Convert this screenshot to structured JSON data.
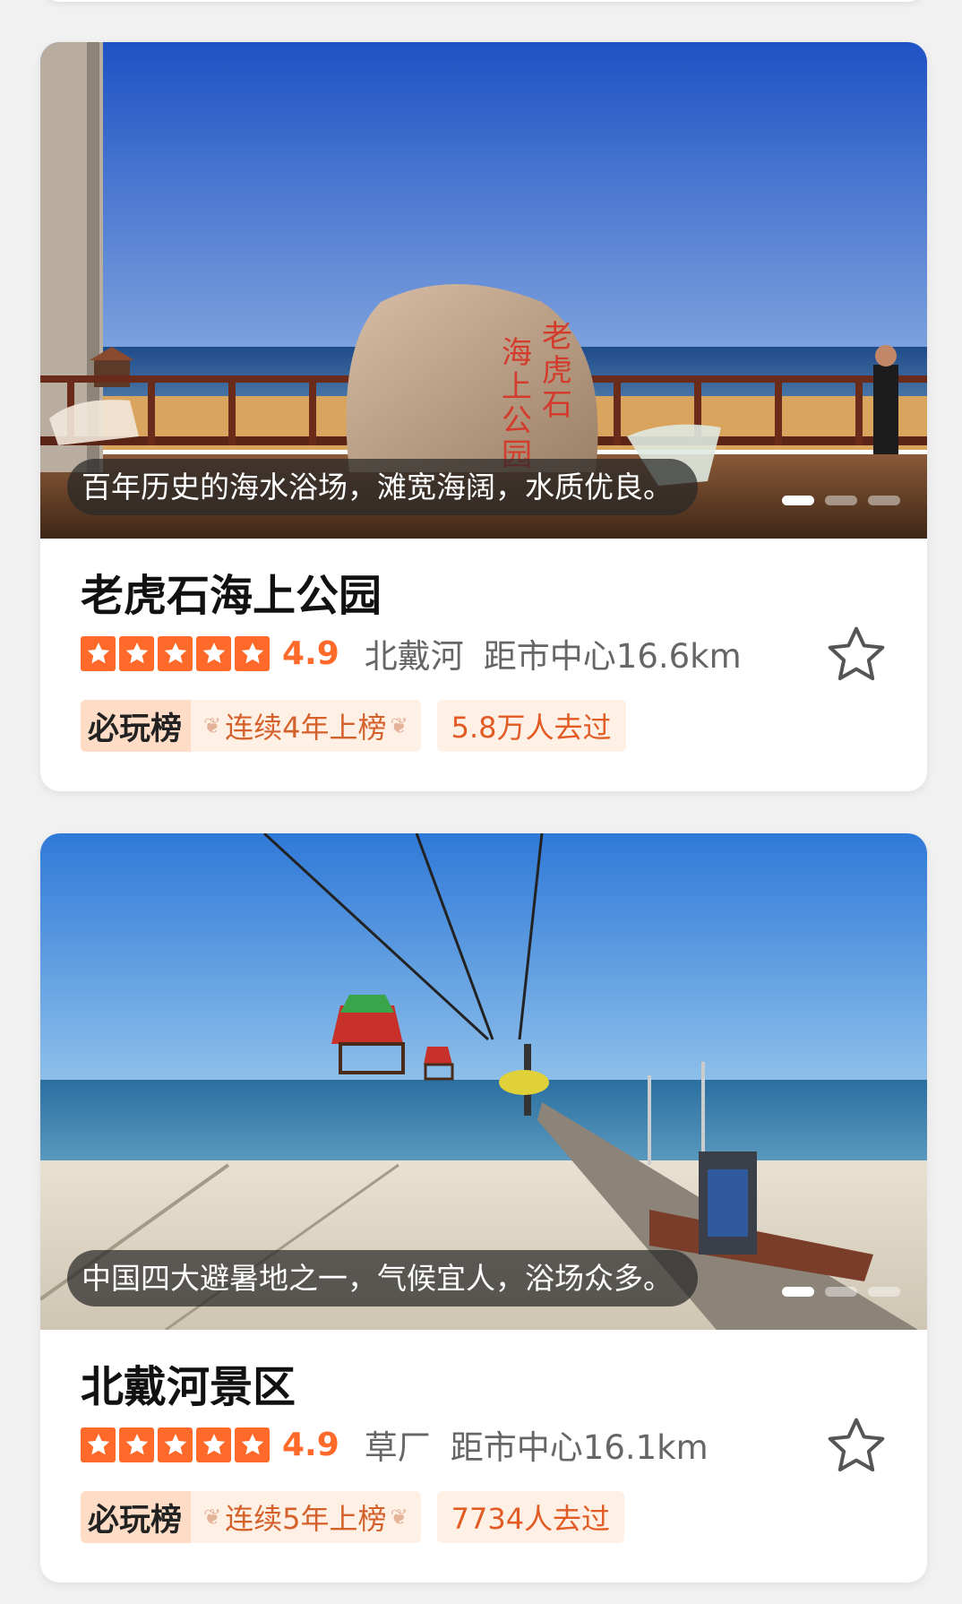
{
  "colors": {
    "accent": "#ff6a2b",
    "badge_bg": "#fff0e6",
    "page_bg": "#f1f1f1"
  },
  "attractions": [
    {
      "name": "老虎石海上公园",
      "caption": "百年历史的海水浴场，滩宽海阔，水质优良。",
      "stone_text": "老虎石海上公园",
      "rating": "4.9",
      "star_count": 5,
      "region": "北戴河",
      "distance": "距市中心16.6km",
      "rank_logo": "必玩榜",
      "rank_text": "连续4年上榜",
      "visited": "5.8万人去过",
      "photo_index": 0,
      "photo_count": 3,
      "favorited": false,
      "icons": {
        "star": "star-icon",
        "favorite": "star-outline-icon",
        "laurel": "laurel-icon"
      }
    },
    {
      "name": "北戴河景区",
      "caption": "中国四大避暑地之一，气候宜人，浴场众多。",
      "rating": "4.9",
      "star_count": 5,
      "region": "草厂",
      "distance": "距市中心16.1km",
      "rank_logo": "必玩榜",
      "rank_text": "连续5年上榜",
      "visited": "7734人去过",
      "photo_index": 0,
      "photo_count": 3,
      "favorited": false,
      "icons": {
        "star": "star-icon",
        "favorite": "star-outline-icon",
        "laurel": "laurel-icon"
      }
    }
  ]
}
